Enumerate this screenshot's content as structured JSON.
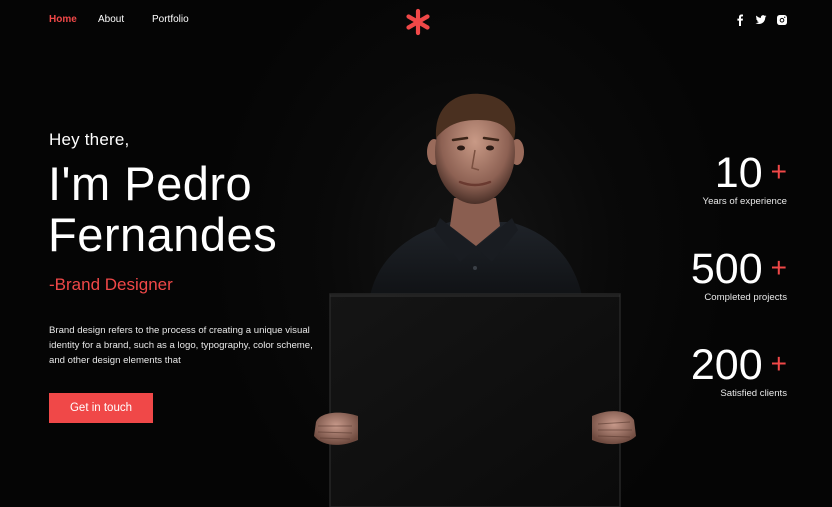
{
  "nav": {
    "home": "Home",
    "about": "About",
    "portfolio": "Portfolio",
    "logo_icon": "asterisk-logo",
    "social": [
      "facebook-icon",
      "twitter-icon",
      "instagram-icon"
    ]
  },
  "hero": {
    "greeting": "Hey there,",
    "name_line1": "I'm Pedro",
    "name_line2": "Fernandes",
    "role": "-Brand Designer",
    "description": "Brand design refers to the process of creating a unique visual identity for a brand, such as a logo, typography, color scheme, and other design elements that",
    "cta_label": "Get in touch"
  },
  "stats": [
    {
      "value": "10",
      "suffix": "+",
      "label": "Years of experience"
    },
    {
      "value": "500",
      "suffix": "+",
      "label": "Completed projects"
    },
    {
      "value": "200",
      "suffix": "+",
      "label": "Satisfied clients"
    }
  ],
  "colors": {
    "accent": "#f04848",
    "background": "#050505",
    "text": "#ffffff"
  }
}
